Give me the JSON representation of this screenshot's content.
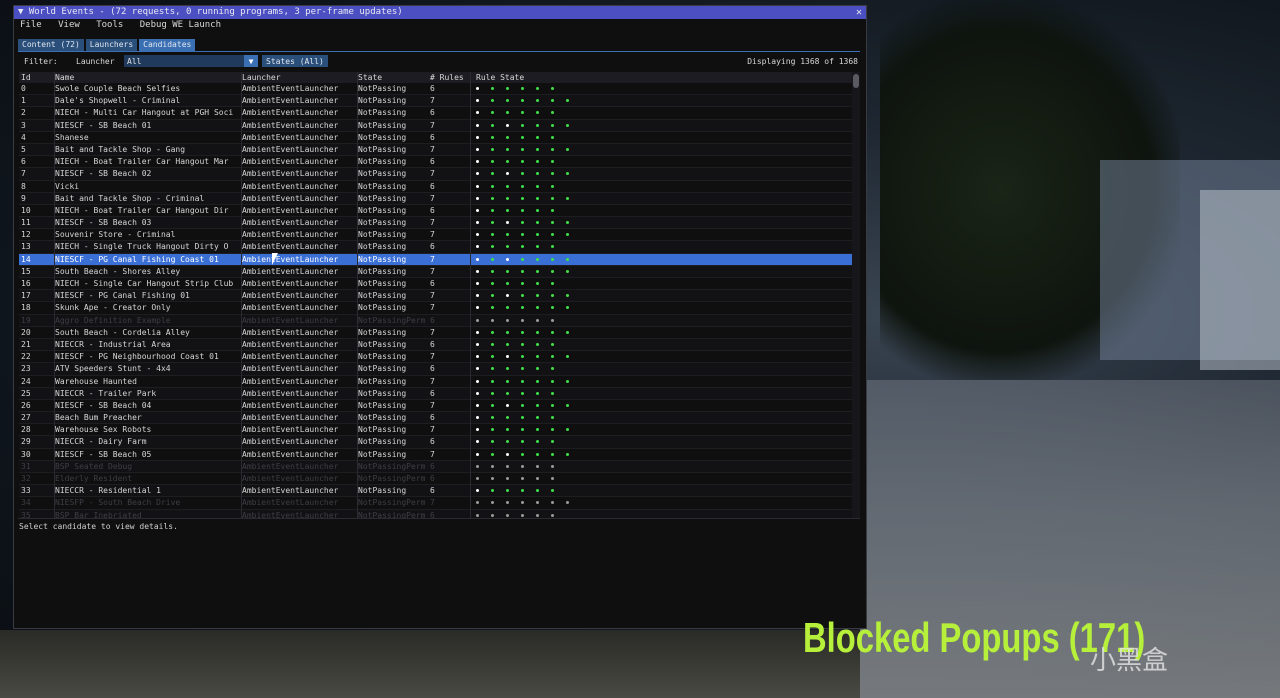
{
  "window": {
    "title": "▼ World Events - (72 requests, 0 running programs, 3 per-frame updates)",
    "close": "✕"
  },
  "menu": [
    "File",
    "View",
    "Tools",
    "Debug WE Launch"
  ],
  "tabs": [
    "Content (72)",
    "Launchers",
    "Candidates"
  ],
  "filter": {
    "label": "Filter:",
    "launcher_label": "Launcher",
    "launcher_value": "All",
    "arrow": "▼",
    "states_button": "States (All)",
    "displaying": "Displaying 1368 of 1368"
  },
  "columns": [
    "Id",
    "Name",
    "Launcher",
    "State",
    "# Rules",
    "Rule State"
  ],
  "rows": [
    {
      "id": "0",
      "name": "Swole Couple Beach Selfies",
      "launcher": "AmbientEventLauncher",
      "state": "NotPassing",
      "rules": "6",
      "dots": "wggggg"
    },
    {
      "id": "1",
      "name": "Dale's Shopwell - Criminal",
      "launcher": "AmbientEventLauncher",
      "state": "NotPassing",
      "rules": "7",
      "dots": "wgggggg"
    },
    {
      "id": "2",
      "name": "NIECH - Multi Car Hangout at PGH Soci",
      "launcher": "AmbientEventLauncher",
      "state": "NotPassing",
      "rules": "6",
      "dots": "wggggg"
    },
    {
      "id": "3",
      "name": "NIESCF - SB Beach 01",
      "launcher": "AmbientEventLauncher",
      "state": "NotPassing",
      "rules": "7",
      "dots": "wgwgggg"
    },
    {
      "id": "4",
      "name": "Shanese",
      "launcher": "AmbientEventLauncher",
      "state": "NotPassing",
      "rules": "6",
      "dots": "wggggg"
    },
    {
      "id": "5",
      "name": "Bait and Tackle Shop - Gang",
      "launcher": "AmbientEventLauncher",
      "state": "NotPassing",
      "rules": "7",
      "dots": "wgggggg"
    },
    {
      "id": "6",
      "name": "NIECH - Boat Trailer Car Hangout Mar",
      "launcher": "AmbientEventLauncher",
      "state": "NotPassing",
      "rules": "6",
      "dots": "wggggg"
    },
    {
      "id": "7",
      "name": "NIESCF - SB Beach 02",
      "launcher": "AmbientEventLauncher",
      "state": "NotPassing",
      "rules": "7",
      "dots": "wgwgggg"
    },
    {
      "id": "8",
      "name": "Vicki",
      "launcher": "AmbientEventLauncher",
      "state": "NotPassing",
      "rules": "6",
      "dots": "wggggg"
    },
    {
      "id": "9",
      "name": "Bait and Tackle Shop - Criminal",
      "launcher": "AmbientEventLauncher",
      "state": "NotPassing",
      "rules": "7",
      "dots": "wgggggg"
    },
    {
      "id": "10",
      "name": "NIECH - Boat Trailer Car Hangout Dir",
      "launcher": "AmbientEventLauncher",
      "state": "NotPassing",
      "rules": "6",
      "dots": "wggggg"
    },
    {
      "id": "11",
      "name": "NIESCF - SB Beach 03",
      "launcher": "AmbientEventLauncher",
      "state": "NotPassing",
      "rules": "7",
      "dots": "wgwgggg"
    },
    {
      "id": "12",
      "name": "Souvenir Store - Criminal",
      "launcher": "AmbientEventLauncher",
      "state": "NotPassing",
      "rules": "7",
      "dots": "wgggggg"
    },
    {
      "id": "13",
      "name": "NIECH - Single Truck Hangout Dirty O",
      "launcher": "AmbientEventLauncher",
      "state": "NotPassing",
      "rules": "6",
      "dots": "wggggg"
    },
    {
      "id": "14",
      "name": "NIESCF - PG Canal Fishing Coast 01",
      "launcher": "AmbientEventLauncher",
      "state": "NotPassing",
      "rules": "7",
      "dots": "wgwgggg",
      "selected": true
    },
    {
      "id": "15",
      "name": "South Beach - Shores Alley",
      "launcher": "AmbientEventLauncher",
      "state": "NotPassing",
      "rules": "7",
      "dots": "wgggggg"
    },
    {
      "id": "16",
      "name": "NIECH - Single Car Hangout Strip Club",
      "launcher": "AmbientEventLauncher",
      "state": "NotPassing",
      "rules": "6",
      "dots": "wggggg"
    },
    {
      "id": "17",
      "name": "NIESCF - PG Canal Fishing 01",
      "launcher": "AmbientEventLauncher",
      "state": "NotPassing",
      "rules": "7",
      "dots": "wgwgggg"
    },
    {
      "id": "18",
      "name": "Skunk Ape - Creator Only",
      "launcher": "AmbientEventLauncher",
      "state": "NotPassing",
      "rules": "7",
      "dots": "wgggggg"
    },
    {
      "id": "19",
      "name": "Aggro Definition Example",
      "launcher": "AmbientEventLauncher",
      "state": "NotPassingPerm",
      "rules": "6",
      "dots": "wwwwww",
      "disabled": true
    },
    {
      "id": "20",
      "name": "South Beach - Cordelia Alley",
      "launcher": "AmbientEventLauncher",
      "state": "NotPassing",
      "rules": "7",
      "dots": "wgggggg"
    },
    {
      "id": "21",
      "name": "NIECCR - Industrial Area",
      "launcher": "AmbientEventLauncher",
      "state": "NotPassing",
      "rules": "6",
      "dots": "wggggg"
    },
    {
      "id": "22",
      "name": "NIESCF - PG Neighbourhood Coast 01",
      "launcher": "AmbientEventLauncher",
      "state": "NotPassing",
      "rules": "7",
      "dots": "wgwgggg"
    },
    {
      "id": "23",
      "name": "ATV Speeders Stunt - 4x4",
      "launcher": "AmbientEventLauncher",
      "state": "NotPassing",
      "rules": "6",
      "dots": "wggggg"
    },
    {
      "id": "24",
      "name": "Warehouse Haunted",
      "launcher": "AmbientEventLauncher",
      "state": "NotPassing",
      "rules": "7",
      "dots": "wgggggg"
    },
    {
      "id": "25",
      "name": "NIECCR - Trailer Park",
      "launcher": "AmbientEventLauncher",
      "state": "NotPassing",
      "rules": "6",
      "dots": "wggggg"
    },
    {
      "id": "26",
      "name": "NIESCF - SB Beach 04",
      "launcher": "AmbientEventLauncher",
      "state": "NotPassing",
      "rules": "7",
      "dots": "wgwgggg"
    },
    {
      "id": "27",
      "name": "Beach Bum Preacher",
      "launcher": "AmbientEventLauncher",
      "state": "NotPassing",
      "rules": "6",
      "dots": "wggggg"
    },
    {
      "id": "28",
      "name": "Warehouse Sex Robots",
      "launcher": "AmbientEventLauncher",
      "state": "NotPassing",
      "rules": "7",
      "dots": "wgggggg"
    },
    {
      "id": "29",
      "name": "NIECCR - Dairy Farm",
      "launcher": "AmbientEventLauncher",
      "state": "NotPassing",
      "rules": "6",
      "dots": "wggggg"
    },
    {
      "id": "30",
      "name": "NIESCF - SB Beach 05",
      "launcher": "AmbientEventLauncher",
      "state": "NotPassing",
      "rules": "7",
      "dots": "wgwgggg"
    },
    {
      "id": "31",
      "name": "BSP Seated Debug",
      "launcher": "AmbientEventLauncher",
      "state": "NotPassingPerm",
      "rules": "6",
      "dots": "wwwwww",
      "disabled": true
    },
    {
      "id": "32",
      "name": "Elderly Resident",
      "launcher": "AmbientEventLauncher",
      "state": "NotPassingPerm",
      "rules": "6",
      "dots": "wwwwww",
      "disabled": true
    },
    {
      "id": "33",
      "name": "NIECCR - Residential 1",
      "launcher": "AmbientEventLauncher",
      "state": "NotPassing",
      "rules": "6",
      "dots": "wggggg"
    },
    {
      "id": "34",
      "name": "NIESFP - South Beach Drive",
      "launcher": "AmbientEventLauncher",
      "state": "NotPassingPerm",
      "rules": "7",
      "dots": "wwwwwww",
      "disabled": true
    },
    {
      "id": "35",
      "name": "BSP Bar Inebriated",
      "launcher": "AmbientEventLauncher",
      "state": "NotPassingPerm",
      "rules": "6",
      "dots": "wwwwww",
      "disabled": true
    }
  ],
  "details": "Select candidate to view details.",
  "overlay_text": "Blocked Popups (171)",
  "watermark": "小黑盒",
  "colors": {
    "green": "#3fe04a",
    "white": "#ffffff",
    "selected": "#3a6fd6",
    "title": "#4b4fc2"
  }
}
